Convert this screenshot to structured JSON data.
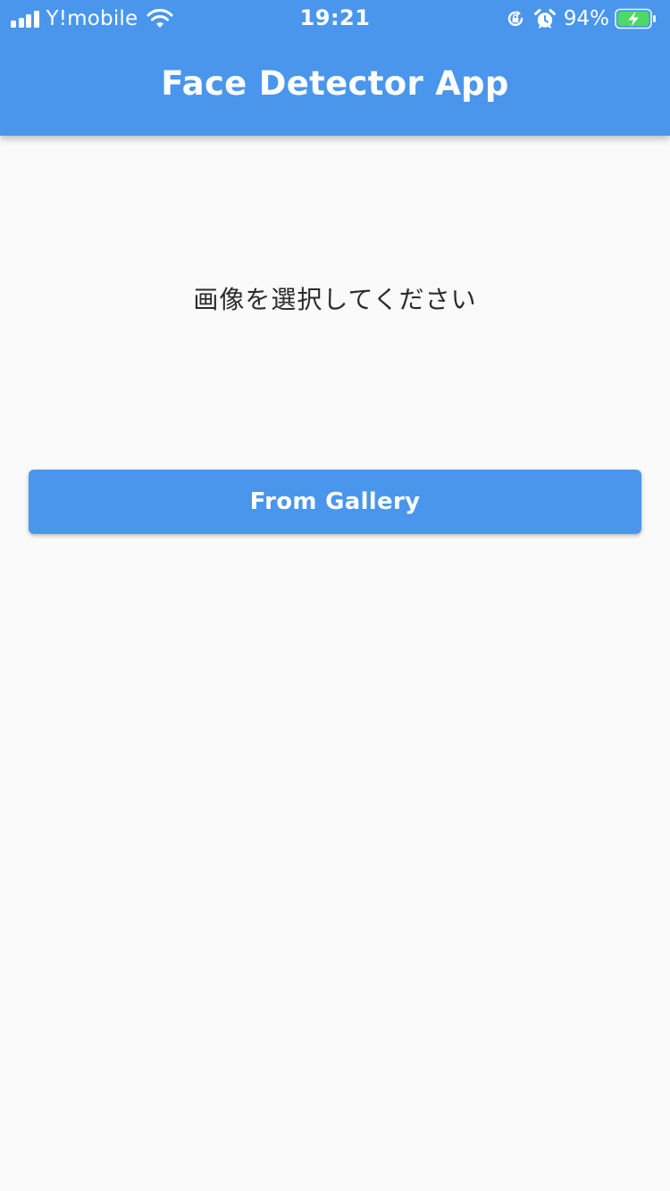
{
  "status_bar": {
    "carrier": "Y!mobile",
    "time": "19:21",
    "battery_percent": "94%",
    "icons": [
      "signal-icon",
      "wifi-icon",
      "orientation-lock-icon",
      "alarm-icon",
      "battery-charging-icon"
    ]
  },
  "app_bar": {
    "title": "Face Detector App"
  },
  "main": {
    "prompt": "画像を選択してください",
    "gallery_button_label": "From Gallery"
  },
  "colors": {
    "primary": "#4a96ec",
    "background": "#fafafa",
    "text": "#2b2b2b",
    "battery_fill": "#4cd964"
  }
}
